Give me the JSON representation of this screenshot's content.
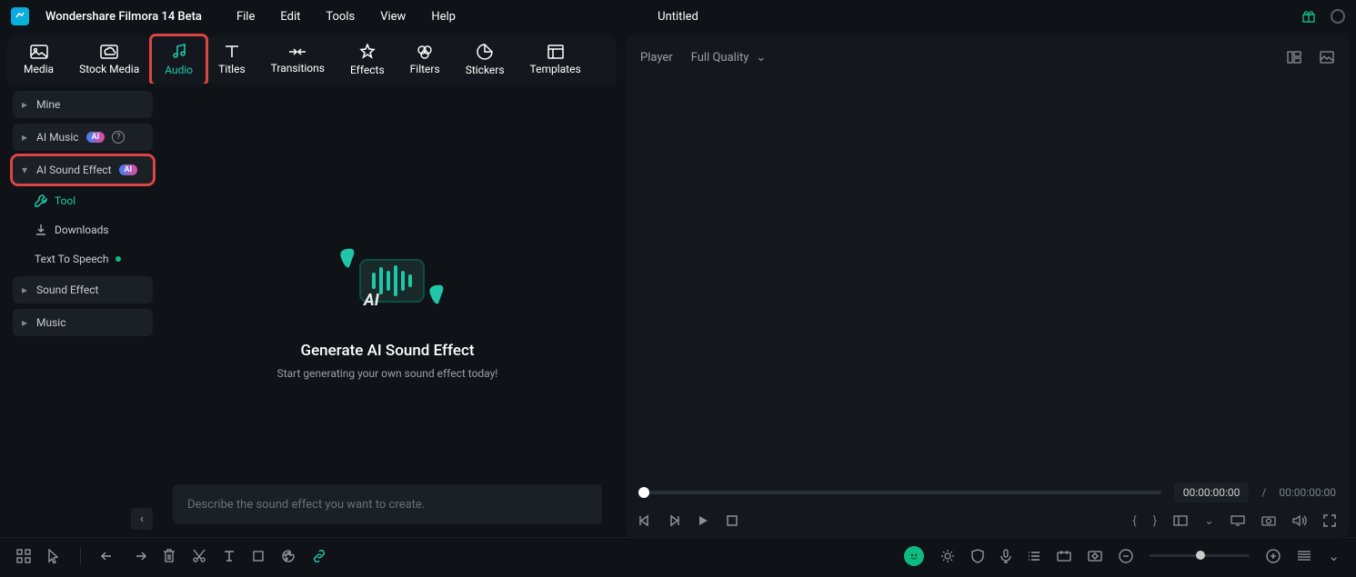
{
  "app_name": "Wondershare Filmora 14 Beta",
  "menu": [
    "File",
    "Edit",
    "Tools",
    "View",
    "Help"
  ],
  "doc_title": "Untitled",
  "tabs": [
    {
      "label": "Media"
    },
    {
      "label": "Stock Media"
    },
    {
      "label": "Audio"
    },
    {
      "label": "Titles"
    },
    {
      "label": "Transitions"
    },
    {
      "label": "Effects"
    },
    {
      "label": "Filters"
    },
    {
      "label": "Stickers"
    },
    {
      "label": "Templates"
    }
  ],
  "sidebar": {
    "mine": "Mine",
    "ai_music": "AI Music",
    "ai_sound": "AI Sound Effect",
    "tool": "Tool",
    "downloads": "Downloads",
    "tts": "Text To Speech",
    "sound_effect": "Sound Effect",
    "music": "Music"
  },
  "content": {
    "heading": "Generate AI Sound Effect",
    "sub": "Start generating your own sound effect today!",
    "placeholder": "Describe the sound effect you want to create."
  },
  "player": {
    "label": "Player",
    "quality": "Full Quality",
    "tc_cur": "00:00:00:00",
    "tc_sep": "/",
    "tc_dur": "00:00:00:00"
  },
  "ai_badge": "AI"
}
